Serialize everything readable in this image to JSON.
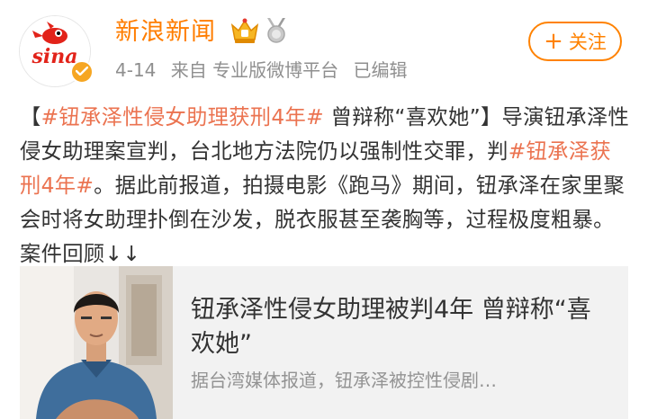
{
  "header": {
    "account_name": "新浪新闻",
    "avatar_text": "sina",
    "date": "4-14",
    "source": "来自 专业版微博平台",
    "edited": "已编辑",
    "follow_label": "关注",
    "follow_icon": "+"
  },
  "post": {
    "segments": [
      {
        "text": "【",
        "type": "text"
      },
      {
        "text": "#钮承泽性侵女助理获刑4年#",
        "type": "tag"
      },
      {
        "text": " 曾辩称“喜欢她”】导演钮承泽性侵女助理案宣判，台北地方法院仍以强制性交罪，判",
        "type": "text"
      },
      {
        "text": "#钮承泽获刑4年#",
        "type": "tag"
      },
      {
        "text": "。据此前报道，拍摄电影《跑马》期间，钮承泽在家里聚会时将女助理扑倒在沙发，脱衣服甚至袭胸等，过程极度粗暴。案件回顾↓↓",
        "type": "text"
      }
    ]
  },
  "card": {
    "title": "钮承泽性侵女助理被判4年 曾辩称“喜欢她”",
    "description": "据台湾媒体报道，钮承泽被控性侵剧…"
  },
  "colors": {
    "name": "#ff7d00",
    "tag": "#eb7350",
    "follow": "#ff8200",
    "meta": "#8f8f8f"
  },
  "icons": {
    "avatar": "sina-logo-avatar",
    "verified": "verified-badge-icon",
    "vip": "crown-badge-icon",
    "medal": "medal-badge-icon"
  }
}
